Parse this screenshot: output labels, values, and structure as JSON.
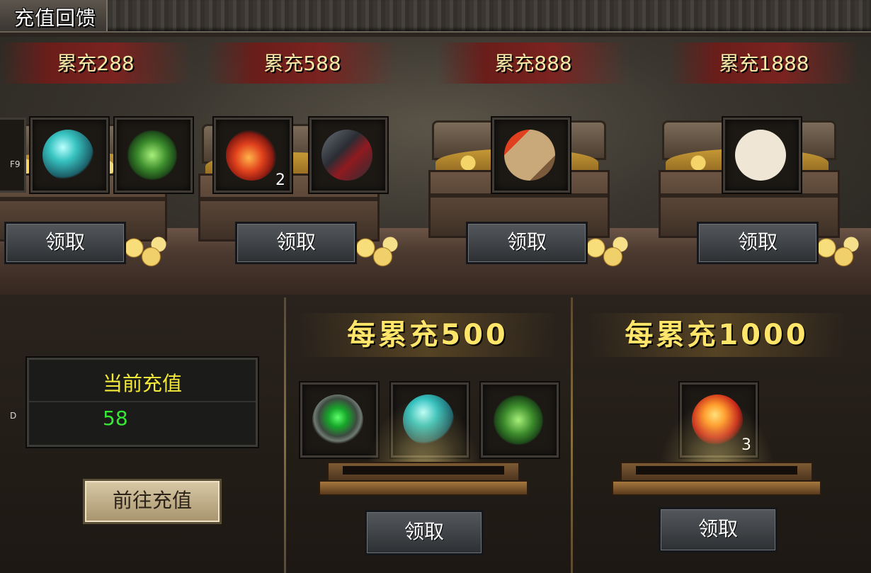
{
  "window": {
    "title": "充值回馈"
  },
  "tiers": [
    {
      "label": "累充288",
      "claim_label": "领取"
    },
    {
      "label": "累充588",
      "claim_label": "领取"
    },
    {
      "label": "累充888",
      "claim_label": "领取"
    },
    {
      "label": "累充1888",
      "claim_label": "领取"
    }
  ],
  "hints": {
    "left_top": "F9",
    "left_bottom": "D"
  },
  "item_counts": {
    "potion": "2",
    "red_gem": "3"
  },
  "current_recharge": {
    "label": "当前充值",
    "value": "58",
    "goto_label": "前往充值"
  },
  "bonus": [
    {
      "label": "每累充500",
      "claim_label": "领取"
    },
    {
      "label": "每累充1000",
      "claim_label": "领取"
    }
  ],
  "icons": {
    "tier1": [
      "partial-item-icon",
      "cyan-jar-icon",
      "green-amulet-icon"
    ],
    "tier2": [
      "red-potion-icon",
      "dark-armor-icon"
    ],
    "tier3": [
      "red-scroll-icon"
    ],
    "tier4": [
      "white-scroll-icon"
    ],
    "bonus500": [
      "green-orb-icon",
      "cyan-jar-icon",
      "green-amulet-icon"
    ],
    "bonus1000": [
      "red-gem-icon"
    ]
  },
  "colors": {
    "title_text": "#ffffff",
    "tier_text": "#f6e9a8",
    "current_label": "#f5e93a",
    "current_value": "#35e835",
    "bonus_text": "#ffe56a"
  }
}
